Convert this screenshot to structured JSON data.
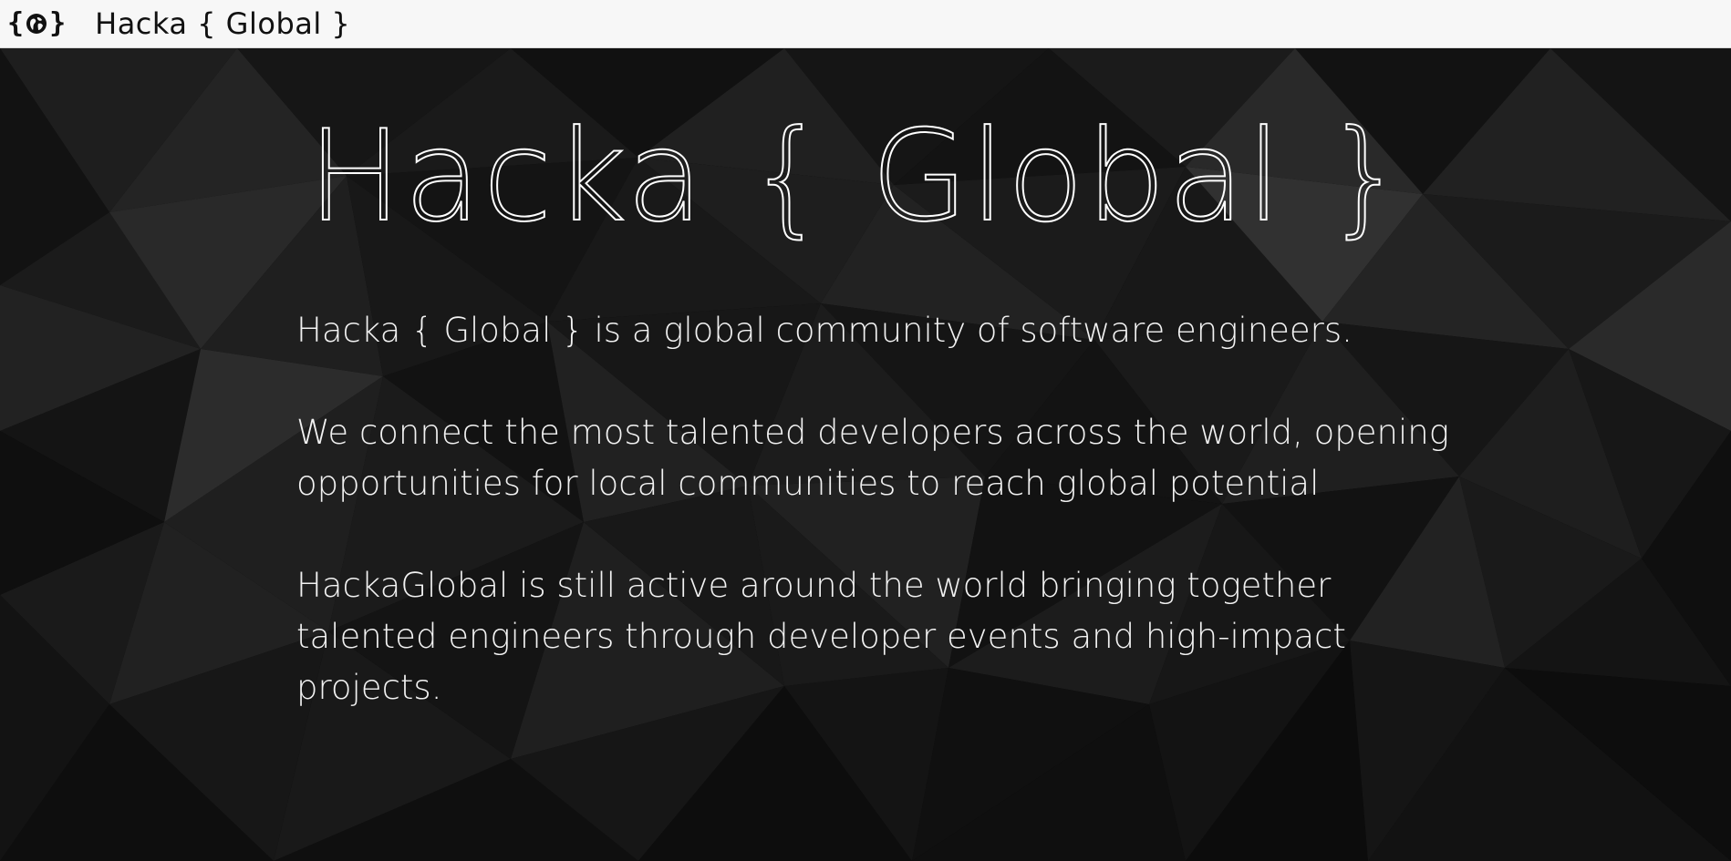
{
  "header": {
    "logo_icon": "globe-icon",
    "logo_open": "{",
    "logo_close": "}",
    "title": "Hacka { Global }"
  },
  "hero": {
    "title": "Hacka { Global }",
    "paragraphs": [
      "Hacka { Global } is a global community of software engineers.",
      "We connect the most talented developers across the world, opening opportunities for local communities to reach global potential",
      "HackaGlobal is still active around the world bringing together talented engineers through developer events and high-impact projects."
    ]
  },
  "colors": {
    "topbar_bg": "#f7f7f7",
    "hero_bg": "#0b0b0b",
    "text": "#f2f2f2"
  }
}
